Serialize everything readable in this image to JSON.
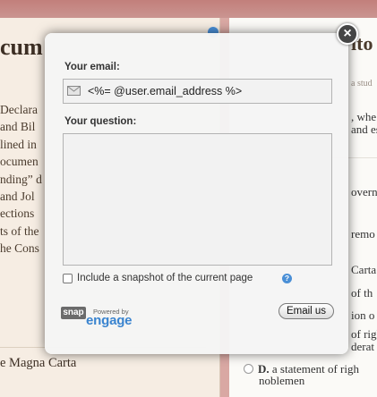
{
  "background": {
    "left_title": "cum",
    "left_lines": [
      "Declara",
      "and Bil",
      "lined in",
      "ocumen",
      "nding” d",
      " and Jol",
      "ections",
      "ts of the",
      "he Cons"
    ],
    "magna_carta": "e Magna Carta",
    "right_title": "ito",
    "right_subtitle": "a stud",
    "right_lines": [
      ", whe",
      "and es"
    ],
    "right_options": [
      "overn",
      "remo",
      "Carta",
      "of th",
      "ion o",
      "of righ",
      "derat"
    ],
    "option_d_letter": "D.",
    "option_d_line1": " a statement of righ",
    "option_d_line2": "noblemen"
  },
  "popup": {
    "close_label": "×",
    "email_label": "Your email:",
    "email_value": "<%= @user.email_address %>",
    "question_label": "Your question:",
    "question_value": "",
    "snapshot_label": "Include a snapshot of the current page",
    "snapshot_checked": false,
    "help_label": "?",
    "snap_logo_text": "snap",
    "powered_by_text": "Powered by",
    "engage_text": "engage",
    "submit_label": "Email us"
  },
  "colors": {
    "accent_blue": "#3a84cf",
    "page_header": "#c27f7b"
  },
  "icons": [
    "mail-icon",
    "help-icon",
    "close-icon",
    "snap-logo"
  ]
}
